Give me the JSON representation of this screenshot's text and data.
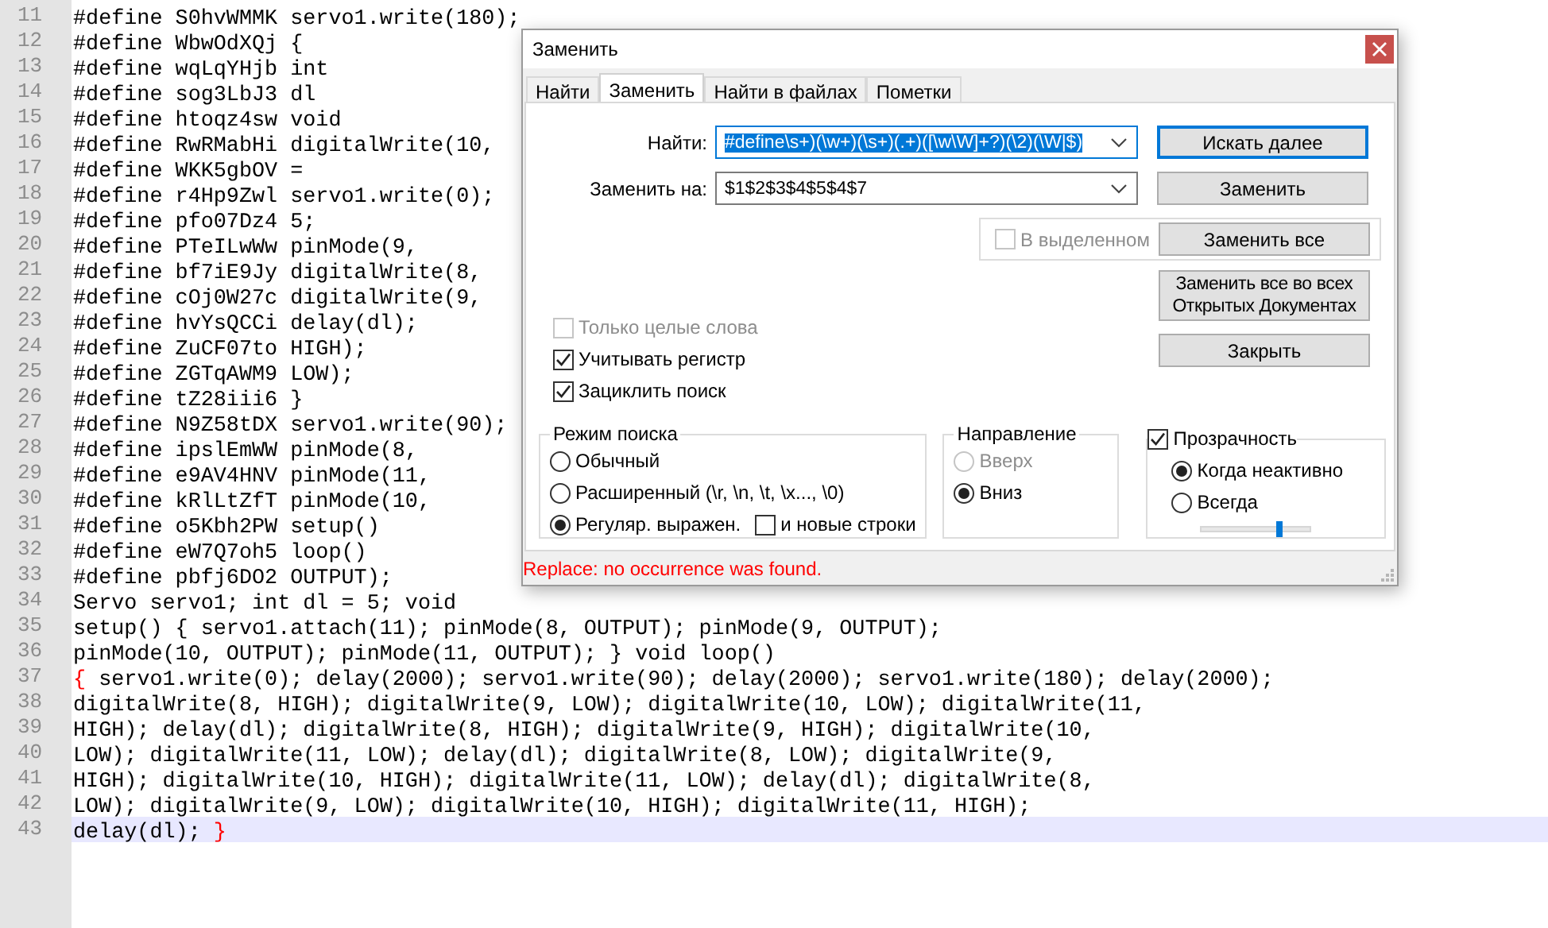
{
  "editor": {
    "lines": [
      {
        "number": "11",
        "current": false,
        "segments": [
          {
            "kind": "code",
            "text": "#define S0hvWMMK servo1.write(180);"
          }
        ]
      },
      {
        "number": "12",
        "current": false,
        "segments": [
          {
            "kind": "code",
            "text": "#define WbwOdXQj {"
          }
        ]
      },
      {
        "number": "13",
        "current": false,
        "segments": [
          {
            "kind": "code",
            "text": "#define wqLqYHjb int"
          }
        ]
      },
      {
        "number": "14",
        "current": false,
        "segments": [
          {
            "kind": "code",
            "text": "#define sog3LbJ3 dl"
          }
        ]
      },
      {
        "number": "15",
        "current": false,
        "segments": [
          {
            "kind": "code",
            "text": "#define htoqz4sw void"
          }
        ]
      },
      {
        "number": "16",
        "current": false,
        "segments": [
          {
            "kind": "code",
            "text": "#define RwRMabHi digitalWrite(10,"
          }
        ]
      },
      {
        "number": "17",
        "current": false,
        "segments": [
          {
            "kind": "code",
            "text": "#define WKK5gbOV ="
          }
        ]
      },
      {
        "number": "18",
        "current": false,
        "segments": [
          {
            "kind": "code",
            "text": "#define r4Hp9Zwl servo1.write(0);"
          }
        ]
      },
      {
        "number": "19",
        "current": false,
        "segments": [
          {
            "kind": "code",
            "text": "#define pfo07Dz4 5;"
          }
        ]
      },
      {
        "number": "20",
        "current": false,
        "segments": [
          {
            "kind": "code",
            "text": "#define PTeILwWw pinMode(9,"
          }
        ]
      },
      {
        "number": "21",
        "current": false,
        "segments": [
          {
            "kind": "code",
            "text": "#define bf7iE9Jy digitalWrite(8,"
          }
        ]
      },
      {
        "number": "22",
        "current": false,
        "segments": [
          {
            "kind": "code",
            "text": "#define cOj0W27c digitalWrite(9,"
          }
        ]
      },
      {
        "number": "23",
        "current": false,
        "segments": [
          {
            "kind": "code",
            "text": "#define hvYsQCCi delay(dl);"
          }
        ]
      },
      {
        "number": "24",
        "current": false,
        "segments": [
          {
            "kind": "code",
            "text": "#define ZuCF07to HIGH);"
          }
        ]
      },
      {
        "number": "25",
        "current": false,
        "segments": [
          {
            "kind": "code",
            "text": "#define ZGTqAWM9 LOW);"
          }
        ]
      },
      {
        "number": "26",
        "current": false,
        "segments": [
          {
            "kind": "code",
            "text": "#define tZ28iii6 }"
          }
        ]
      },
      {
        "number": "27",
        "current": false,
        "segments": [
          {
            "kind": "code",
            "text": "#define N9Z58tDX servo1.write(90);"
          }
        ]
      },
      {
        "number": "28",
        "current": false,
        "segments": [
          {
            "kind": "code",
            "text": "#define ipslEmWW pinMode(8,"
          }
        ]
      },
      {
        "number": "29",
        "current": false,
        "segments": [
          {
            "kind": "code",
            "text": "#define e9AV4HNV pinMode(11,"
          }
        ]
      },
      {
        "number": "30",
        "current": false,
        "segments": [
          {
            "kind": "code",
            "text": "#define kRlLtZfT pinMode(10,"
          }
        ]
      },
      {
        "number": "31",
        "current": false,
        "segments": [
          {
            "kind": "code",
            "text": "#define o5Kbh2PW setup()"
          }
        ]
      },
      {
        "number": "32",
        "current": false,
        "segments": [
          {
            "kind": "code",
            "text": "#define eW7Q7oh5 loop()"
          }
        ]
      },
      {
        "number": "33",
        "current": false,
        "segments": [
          {
            "kind": "code",
            "text": "#define pbfj6DO2 OUTPUT);"
          }
        ]
      },
      {
        "number": "34",
        "current": false,
        "segments": [
          {
            "kind": "code",
            "text": "Servo servo1; int dl = 5; void"
          }
        ]
      },
      {
        "number": "35",
        "current": false,
        "segments": [
          {
            "kind": "code",
            "text": "setup() { servo1.attach(11); pinMode(8, OUTPUT); pinMode(9, OUTPUT);"
          }
        ]
      },
      {
        "number": "36",
        "current": false,
        "segments": [
          {
            "kind": "code",
            "text": "pinMode(10, OUTPUT); pinMode(11, OUTPUT); } void loop()"
          }
        ]
      },
      {
        "number": "37",
        "current": false,
        "segments": [
          {
            "kind": "brace",
            "text": "{"
          },
          {
            "kind": "code",
            "text": " servo1.write(0); delay(2000); servo1.write(90); delay(2000); servo1.write(180); delay(2000);"
          }
        ]
      },
      {
        "number": "38",
        "current": false,
        "segments": [
          {
            "kind": "code",
            "text": "digitalWrite(8, HIGH); digitalWrite(9, LOW); digitalWrite(10, LOW); digitalWrite(11,"
          }
        ]
      },
      {
        "number": "39",
        "current": false,
        "segments": [
          {
            "kind": "code",
            "text": "HIGH); delay(dl); digitalWrite(8, HIGH); digitalWrite(9, HIGH); digitalWrite(10,"
          }
        ]
      },
      {
        "number": "40",
        "current": false,
        "segments": [
          {
            "kind": "code",
            "text": "LOW); digitalWrite(11, LOW); delay(dl); digitalWrite(8, LOW); digitalWrite(9,"
          }
        ]
      },
      {
        "number": "41",
        "current": false,
        "segments": [
          {
            "kind": "code",
            "text": "HIGH); digitalWrite(10, HIGH); digitalWrite(11, LOW); delay(dl); digitalWrite(8,"
          }
        ]
      },
      {
        "number": "42",
        "current": false,
        "segments": [
          {
            "kind": "code",
            "text": "LOW); digitalWrite(9, LOW); digitalWrite(10, HIGH); digitalWrite(11, HIGH);"
          }
        ]
      },
      {
        "number": "43",
        "current": true,
        "segments": [
          {
            "kind": "code",
            "text": "delay(dl); "
          },
          {
            "kind": "brace",
            "text": "}"
          }
        ]
      }
    ]
  },
  "dialog": {
    "title": "Заменить",
    "tabs": [
      {
        "label": "Найти",
        "selected": false
      },
      {
        "label": "Заменить",
        "selected": true
      },
      {
        "label": "Найти в файлах",
        "selected": false
      },
      {
        "label": "Пометки",
        "selected": false
      }
    ],
    "find": {
      "label": "Найти:",
      "value": "#define\\s+)(\\w+)(\\s+)(.+)([\\w\\W]+?)(\\2)(\\W|$)",
      "selected": true
    },
    "replace": {
      "label": "Заменить на:",
      "value": "$1$2$3$4$5$4$7",
      "selected": false
    },
    "buttons": [
      {
        "label": "Искать далее",
        "default": true
      },
      {
        "label": "Заменить",
        "default": false
      },
      {
        "label": "Заменить все",
        "default": false
      },
      {
        "label": "Заменить все во всех Открытых Документах",
        "default": false
      },
      {
        "label": "Закрыть",
        "default": false
      }
    ],
    "in_selection": {
      "label": "В выделенном",
      "checked": false,
      "disabled": true
    },
    "options": [
      {
        "label": "Только целые слова",
        "checked": false,
        "disabled": true
      },
      {
        "label": "Учитывать регистр",
        "checked": true,
        "disabled": false
      },
      {
        "label": "Зациклить поиск",
        "checked": true,
        "disabled": false
      }
    ],
    "search_mode": {
      "title": "Режим поиска",
      "modes": [
        {
          "label": "Обычный",
          "selected": false
        },
        {
          "label": "Расширенный (\\r, \\n, \\t, \\x..., \\0)",
          "selected": false
        },
        {
          "label": "Регуляр. выражен.",
          "selected": true
        }
      ],
      "newlines": {
        "label": "и новые строки",
        "checked": false
      }
    },
    "direction": {
      "title": "Направление",
      "options": [
        {
          "label": "Вверх",
          "selected": false,
          "disabled": true
        },
        {
          "label": "Вниз",
          "selected": true,
          "disabled": false
        }
      ]
    },
    "transparency": {
      "label": "Прозрачность",
      "checked": true,
      "options": [
        {
          "label": "Когда неактивно",
          "selected": true
        },
        {
          "label": "Всегда",
          "selected": false
        }
      ],
      "level": 0.71
    },
    "message": {
      "kind": "error",
      "text": "Replace: no occurrence was found."
    }
  }
}
